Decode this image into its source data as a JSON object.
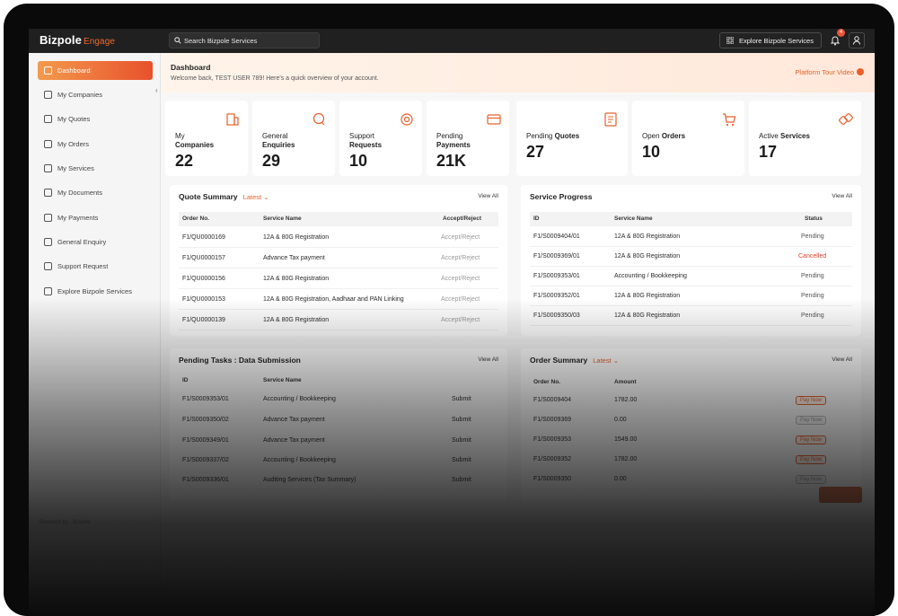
{
  "brand": {
    "name": "Bizpole",
    "product": "Engage"
  },
  "search": {
    "placeholder": "Search Bizpole Services"
  },
  "header": {
    "explore_label": "Explore Bizpole Services",
    "notification_count": "4"
  },
  "sidebar": {
    "items": [
      {
        "label": "Dashboard",
        "icon": "home-icon",
        "active": true
      },
      {
        "label": "My Companies",
        "icon": "building-icon"
      },
      {
        "label": "My Quotes",
        "icon": "quote-icon"
      },
      {
        "label": "My Orders",
        "icon": "cart-icon"
      },
      {
        "label": "My Services",
        "icon": "services-icon"
      },
      {
        "label": "My Documents",
        "icon": "document-icon"
      },
      {
        "label": "My Payments",
        "icon": "payment-icon"
      },
      {
        "label": "General Enquiry",
        "icon": "enquiry-icon"
      },
      {
        "label": "Support Request",
        "icon": "support-icon"
      },
      {
        "label": "Explore Bizpole Services",
        "icon": "explore-icon"
      }
    ],
    "powered": "Powered by · Bizpole"
  },
  "welcome": {
    "title": "Dashboard",
    "subtitle": "Welcome back, TEST USER 789! Here's a quick overview of your account.",
    "tour_label": "Platform Tour Video"
  },
  "stats": [
    {
      "line1": "My",
      "line2": "Companies",
      "value": "22",
      "icon": "building-icon"
    },
    {
      "line1": "General",
      "line2": "Enquiries",
      "value": "29",
      "icon": "enquiry-icon"
    },
    {
      "line1": "Support",
      "line2": "Requests",
      "value": "10",
      "icon": "support-icon"
    },
    {
      "line1": "Pending",
      "line2": "Payments",
      "value": "21K",
      "icon": "payment-icon"
    },
    {
      "line1": "Pending",
      "line2": "Quotes",
      "value": "27",
      "icon": "quote-icon"
    },
    {
      "line1": "Open",
      "line2": "Orders",
      "value": "10",
      "icon": "cart-icon"
    },
    {
      "line1": "Active",
      "line2": "Services",
      "value": "17",
      "icon": "services-icon"
    }
  ],
  "quote_summary": {
    "title": "Quote Summary",
    "filter": "Latest",
    "view_all": "View All",
    "columns": [
      "Order No.",
      "Service Name",
      "Accept/Reject"
    ],
    "rows": [
      [
        "F1/QU0000169",
        "12A & 80G Registration",
        "Accept/Reject"
      ],
      [
        "F1/QU0000157",
        "Advance Tax payment",
        "Accept/Reject"
      ],
      [
        "F1/QU0000156",
        "12A & 80G Registration",
        "Accept/Reject"
      ],
      [
        "F1/QU0000153",
        "12A & 80G Registration, Aadhaar and PAN Linking",
        "Accept/Reject"
      ],
      [
        "F1/QU0000139",
        "12A & 80G Registration",
        "Accept/Reject"
      ]
    ]
  },
  "service_progress": {
    "title": "Service Progress",
    "view_all": "View All",
    "columns": [
      "ID",
      "Service Name",
      "Status"
    ],
    "rows": [
      [
        "F1/S0009404/01",
        "12A & 80G Registration",
        "Pending"
      ],
      [
        "F1/S0009369/01",
        "12A & 80G Registration",
        "Cancelled"
      ],
      [
        "F1/S0009353/01",
        "Accounting / Bookkeeping",
        "Pending"
      ],
      [
        "F1/S0009352/01",
        "12A & 80G Registration",
        "Pending"
      ],
      [
        "F1/S0009350/03",
        "12A & 80G Registration",
        "Pending"
      ]
    ]
  },
  "pending_tasks": {
    "title": "Pending Tasks : Data Submission",
    "view_all": "View All",
    "columns": [
      "ID",
      "Service Name",
      ""
    ],
    "rows": [
      [
        "F1/S0009353/01",
        "Accounting / Bookkeeping",
        "Submit"
      ],
      [
        "F1/S0009350/02",
        "Advance Tax payment",
        "Submit"
      ],
      [
        "F1/S0009349/01",
        "Advance Tax payment",
        "Submit"
      ],
      [
        "F1/S0009337/02",
        "Accounting / Bookkeeping",
        "Submit"
      ],
      [
        "F1/S0009336/01",
        "Auditing Services (Tax Summary)",
        "Submit"
      ]
    ]
  },
  "order_summary": {
    "title": "Order Summary",
    "filter": "Latest",
    "view_all": "View All",
    "columns": [
      "Order No.",
      "Amount",
      ""
    ],
    "rows": [
      [
        "F1/S0009404",
        "1782.00",
        "Pay Now"
      ],
      [
        "F1/S0009369",
        "0.00",
        "Pay Now"
      ],
      [
        "F1/S0009353",
        "1549.00",
        "Pay Now"
      ],
      [
        "F1/S0009352",
        "1782.00",
        "Pay Now"
      ],
      [
        "F1/S0009350",
        "0.00",
        "Pay Now"
      ]
    ]
  },
  "colors": {
    "accent": "#e8602a",
    "topbar": "#202020",
    "cancelled": "#d9412b"
  }
}
